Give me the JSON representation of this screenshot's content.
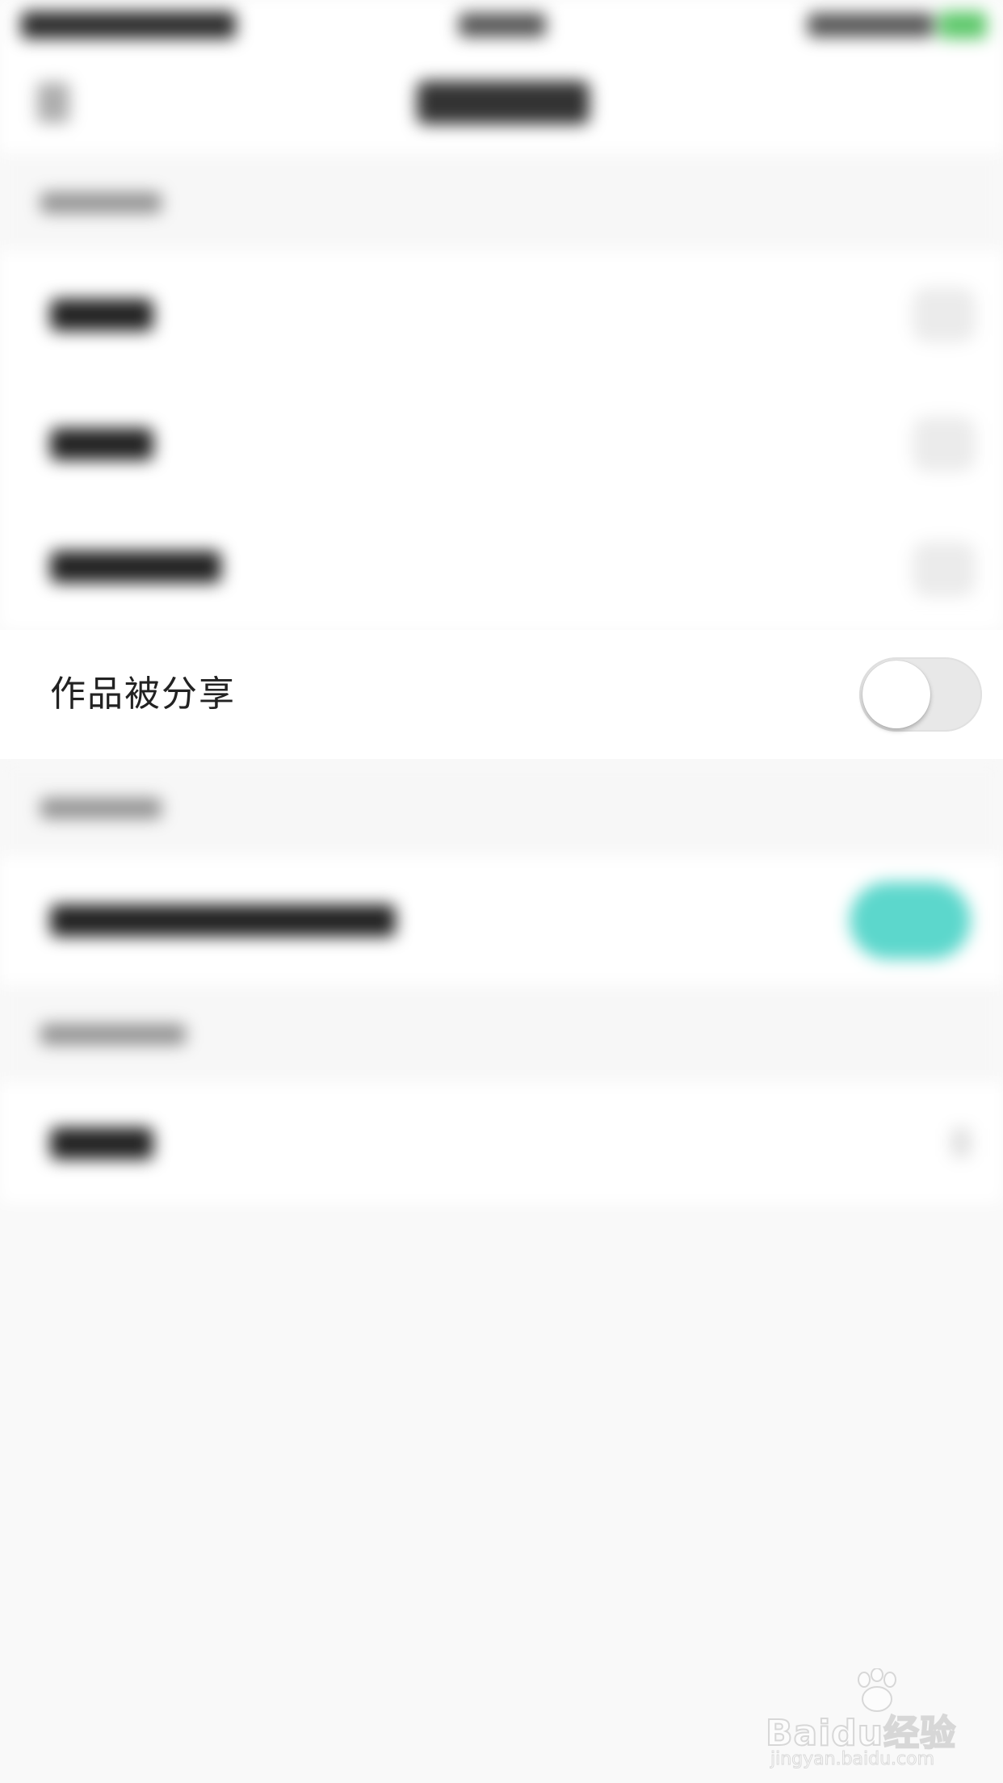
{
  "settings": {
    "share_row": {
      "label": "作品被分享",
      "toggle_on": false
    }
  },
  "watermark": {
    "brand": "Baidu经验",
    "url": "jingyan.baidu.com"
  },
  "colors": {
    "background": "#f9f9f9",
    "cell_background": "#ffffff",
    "toggle_off": "#e8e8e8",
    "toggle_on": "#5cd7cc",
    "battery": "#5ec86b"
  }
}
